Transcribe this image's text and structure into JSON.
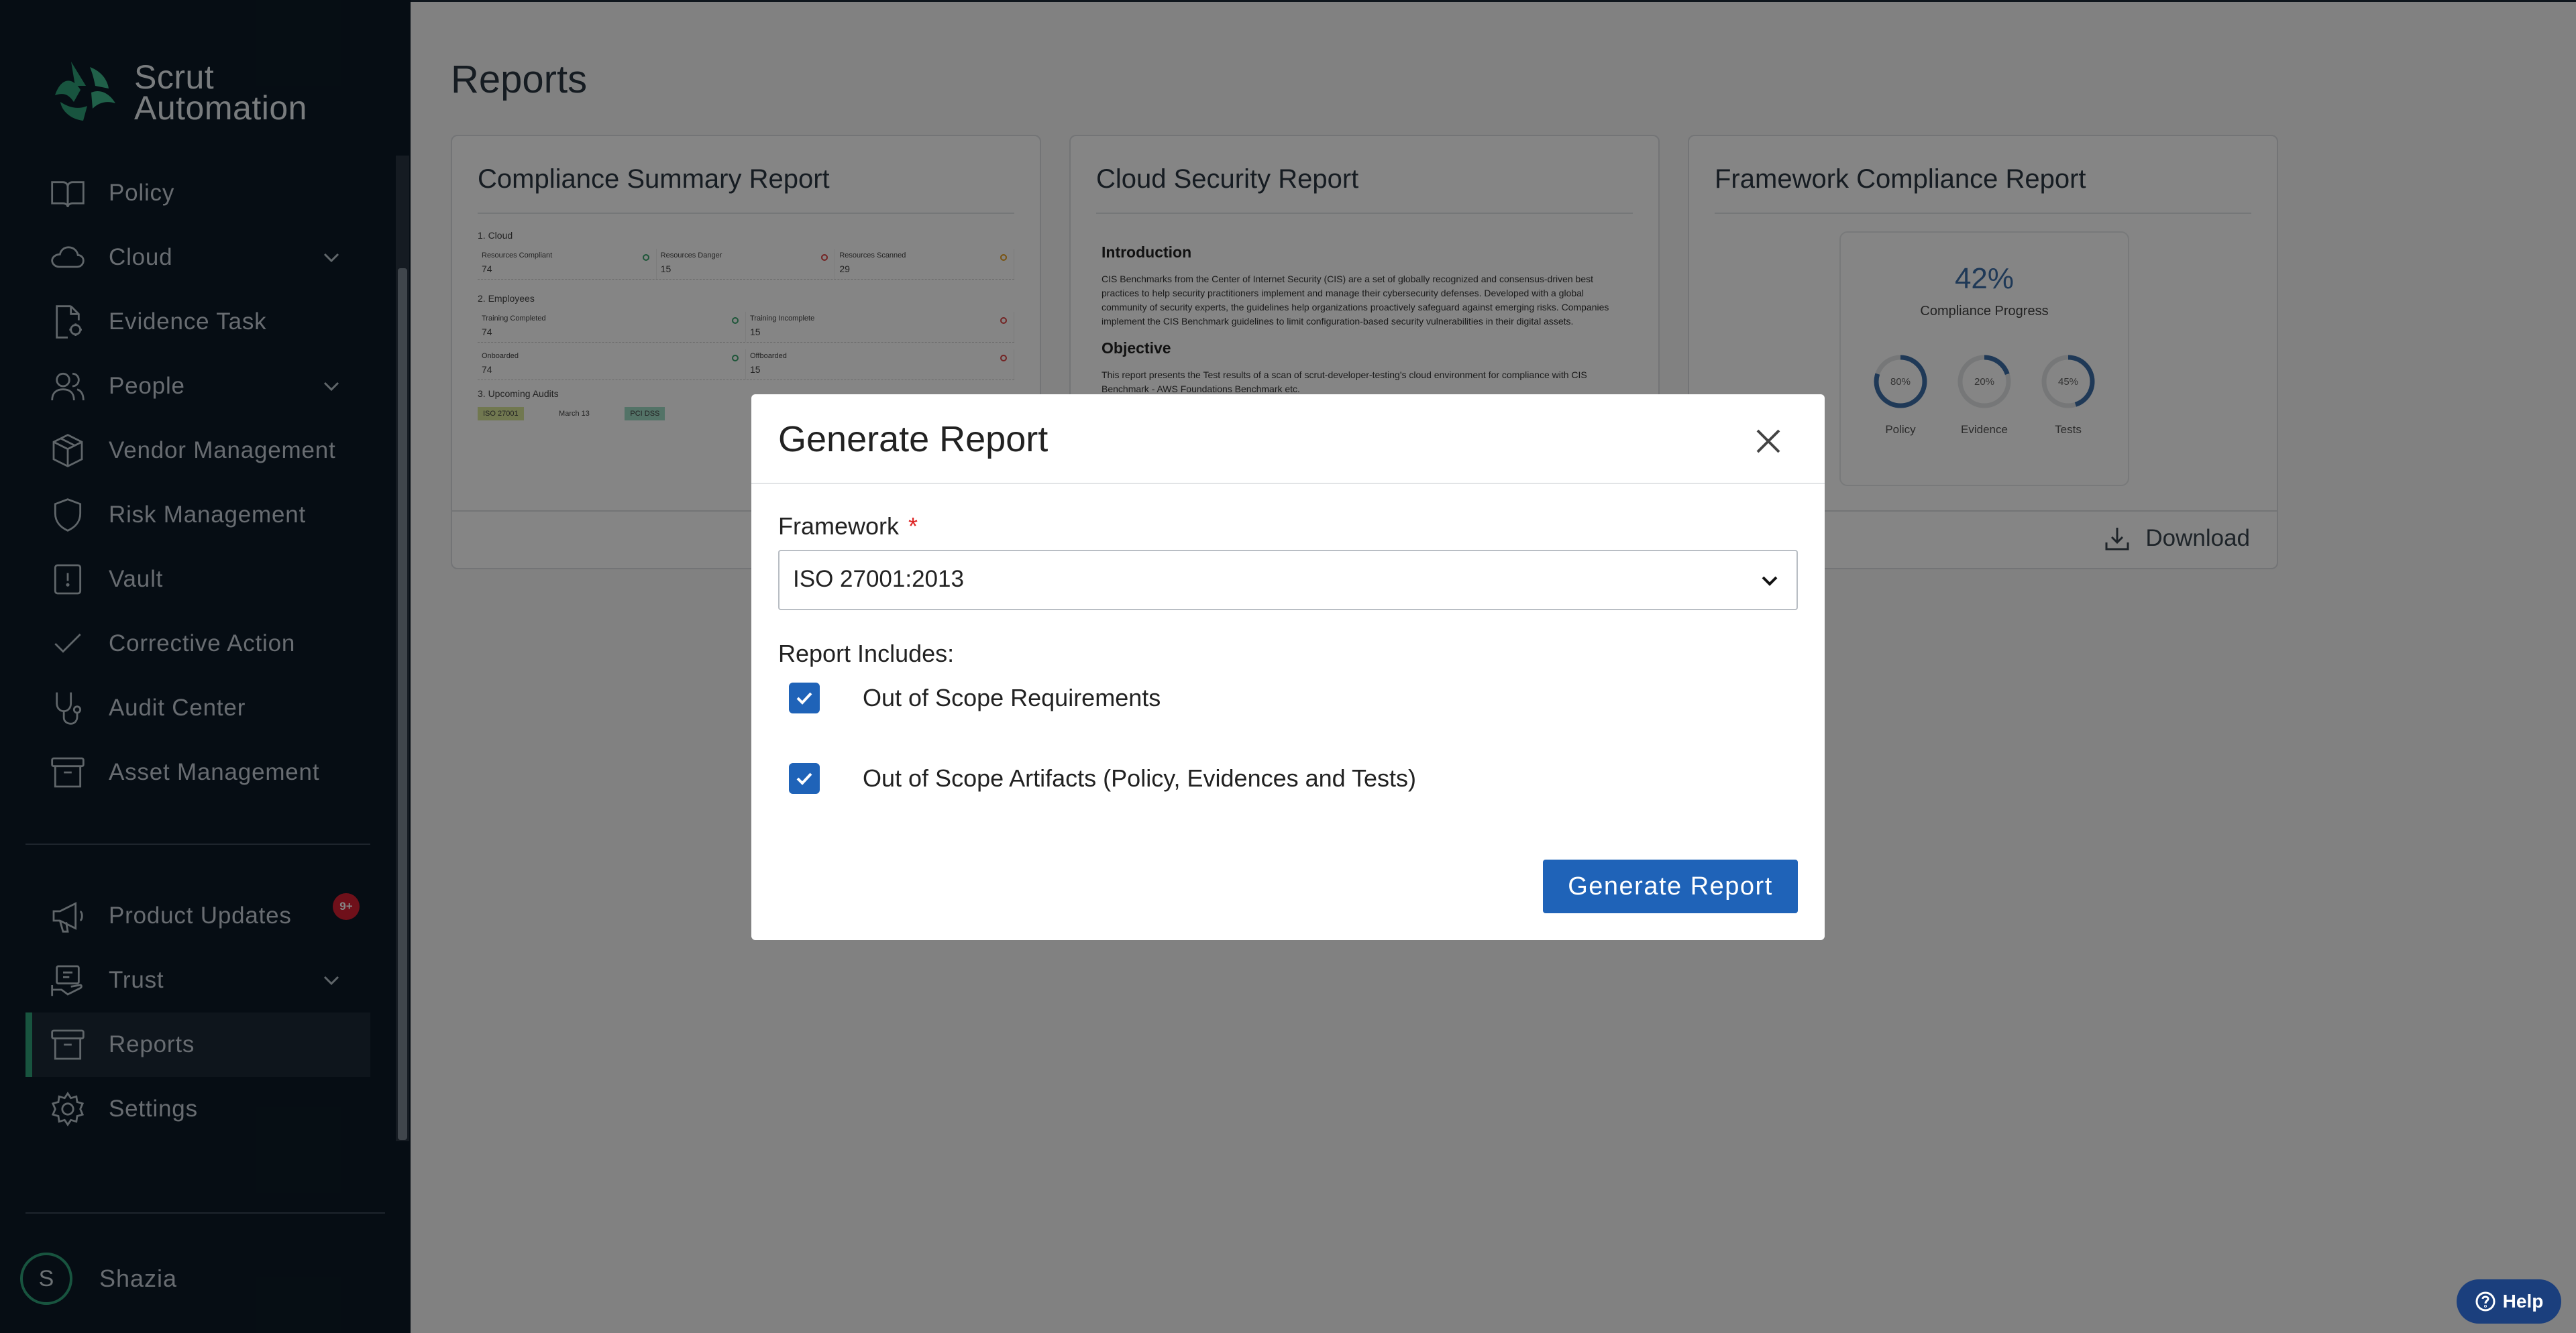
{
  "brand": {
    "name_line1": "Scrut",
    "name_line2": "Automation",
    "accent": "#2fa27a"
  },
  "sidebar": {
    "items": [
      {
        "label": "Policy",
        "icon": "book-icon"
      },
      {
        "label": "Cloud",
        "icon": "cloud-icon",
        "expandable": true
      },
      {
        "label": "Evidence Task",
        "icon": "evidence-icon"
      },
      {
        "label": "People",
        "icon": "people-icon",
        "expandable": true
      },
      {
        "label": "Vendor Management",
        "icon": "box-icon"
      },
      {
        "label": "Risk Management",
        "icon": "shield-icon"
      },
      {
        "label": "Vault",
        "icon": "vault-icon"
      },
      {
        "label": "Corrective Action",
        "icon": "check-icon"
      },
      {
        "label": "Audit Center",
        "icon": "stethoscope-icon"
      },
      {
        "label": "Asset Management",
        "icon": "archive-icon"
      }
    ],
    "bottom_items": [
      {
        "label": "Product Updates",
        "icon": "megaphone-icon",
        "badge": "9+"
      },
      {
        "label": "Trust",
        "icon": "trust-icon",
        "expandable": true
      },
      {
        "label": "Reports",
        "icon": "archive-icon",
        "active": true
      },
      {
        "label": "Settings",
        "icon": "gear-icon"
      }
    ],
    "user": {
      "initial": "S",
      "name": "Shazia"
    }
  },
  "main": {
    "title": "Reports",
    "cards": [
      {
        "title": "Compliance Summary Report",
        "preview": {
          "sec1": "1. Cloud",
          "cloud_cells": [
            {
              "label": "Resources Compliant",
              "value": "74"
            },
            {
              "label": "Resources Danger",
              "value": "15"
            },
            {
              "label": "Resources Scanned",
              "value": "29"
            }
          ],
          "sec2": "2. Employees",
          "emp_row1": [
            {
              "label": "Training Completed",
              "value": "74"
            },
            {
              "label": "Training Incomplete",
              "value": "15"
            }
          ],
          "emp_row2": [
            {
              "label": "Onboarded",
              "value": "74"
            },
            {
              "label": "Offboarded",
              "value": "15"
            }
          ],
          "sec3": "3. Upcoming Audits",
          "audit_tag1": "ISO 27001",
          "audit_date": "March 13",
          "audit_tag2": "PCI DSS"
        }
      },
      {
        "title": "Cloud Security Report",
        "preview": {
          "h1": "Introduction",
          "p1": "CIS Benchmarks from the Center of Internet Security (CIS) are a set of globally recognized and consensus-driven best practices to help security practitioners implement and manage their cybersecurity defenses. Developed with a global community of security experts, the guidelines help organizations proactively safeguard against emerging risks. Companies implement the CIS Benchmark guidelines to limit configuration-based security vulnerabilities in their digital assets.",
          "h2": "Objective",
          "p2": "This report presents the Test results of a scan of scrut-developer-testing's cloud environment for compliance with CIS Benchmark - AWS Foundations Benchmark etc."
        }
      },
      {
        "title": "Framework Compliance Report",
        "preview": {
          "percent": "42%",
          "subtitle": "Compliance Progress",
          "rings": [
            {
              "value": "80%",
              "label": "Policy",
              "fraction": 0.8
            },
            {
              "value": "20%",
              "label": "Evidence",
              "fraction": 0.2
            },
            {
              "value": "45%",
              "label": "Tests",
              "fraction": 0.45
            }
          ]
        },
        "download_label": "Download"
      }
    ]
  },
  "modal": {
    "title": "Generate Report",
    "framework_label": "Framework",
    "required_mark": "*",
    "framework_value": "ISO 27001:2013",
    "includes_label": "Report Includes:",
    "options": [
      {
        "label": "Out of Scope Requirements",
        "checked": true
      },
      {
        "label": "Out of Scope Artifacts (Policy, Evidences and Tests)",
        "checked": true
      }
    ],
    "submit_label": "Generate Report"
  },
  "help": {
    "label": "Help"
  },
  "colors": {
    "sidebar_bg": "#0c1a27",
    "primary": "#1f63b8",
    "ring": "#3d6da8"
  }
}
